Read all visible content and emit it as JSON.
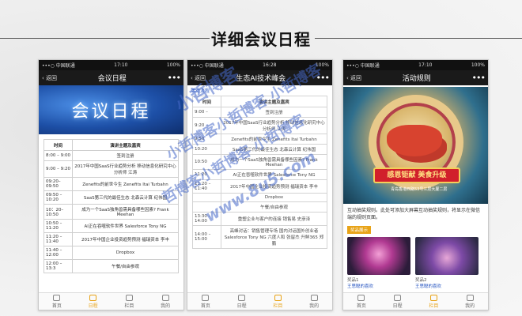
{
  "page": {
    "heading": "详细会议日程"
  },
  "phone1": {
    "status": {
      "carrier": "•••○ 中国联通",
      "time": "17:10",
      "battery": "100%"
    },
    "nav": {
      "back": "返回",
      "title": "会议日程",
      "more": "•••"
    },
    "banner_text": "会议日程",
    "table": {
      "headers": [
        "时间",
        "演讲主题及嘉宾"
      ],
      "rows": [
        [
          "8:00 – 9:00",
          "签到注册"
        ],
        [
          "9:00 – 9:20",
          "2017年中国SaaS行业趋势分析 移动信息化研究中心 分析师 江涛"
        ],
        [
          "09:20–09:50",
          "Zenefits的前世今生 Zenefits Itai Turbahn"
        ],
        [
          "09:50 – 10:20",
          "SaaS第三代的最佳生态 北森云计算 纪伟国"
        ],
        [
          "10：20–10:50",
          "成为一个SaaS独角兽需具备哪些因素? Frank Meehan"
        ],
        [
          "10:50 – 11:20",
          "AI正在吞噬软件世界 Salesforce Tony NG"
        ],
        [
          "11:20 – 11:40",
          "2017年中国企业投资趋势预测 福瑞资本 李丰"
        ],
        [
          "11:40 – 12:00",
          "Dropbox"
        ],
        [
          "12:00 – 13:3",
          "午餐/自由参观"
        ]
      ]
    },
    "tabs": [
      "首页",
      "日程",
      "栏目",
      "我的"
    ],
    "active_tab": "日程"
  },
  "phone2": {
    "status": {
      "carrier": "•••○ 中国联通",
      "time": "16:28",
      "battery": "100%"
    },
    "nav": {
      "back": "返回",
      "title": "生态AI技术峰会",
      "more": "•••"
    },
    "sub_label": "活动流程",
    "table": {
      "headers": [
        "时间",
        "演讲主题及嘉宾"
      ],
      "rows": [
        [
          "9:00 –",
          "签到注册"
        ],
        [
          "9:20 –",
          "2017年中国SaaS行业趋势分析 移动信息化研究中心 分析师 江涛"
        ],
        [
          "9:50",
          "Zenefits的前世今生 Zenefits Itai Turbahn"
        ],
        [
          "10:20",
          "SaaS第三代的最佳生态 北森云计算 纪伟国"
        ],
        [
          "10:50",
          "成为一个SaaS独角兽需具备哪些因素? Frank Meehan"
        ],
        [
          "11:20",
          "AI正在吞噬软件世界 Salesforce Tony NG"
        ],
        [
          "11:20 – 11:40",
          "2017年中国企业投资趋势预测 福瑞资本 李丰"
        ],
        [
          "",
          "Dropbox"
        ],
        [
          "",
          "午餐/自由参观"
        ],
        [
          "13:30 – 14:00",
          "重塑企业与客户的连接 销售易 史彦泽"
        ],
        [
          "14:00 – 15:00",
          "高峰对话：销售管理专场 国内对话国外创业者 Salesforce Tony NG 六度人和 张留杰 升鲜365 郑鹏"
        ]
      ]
    },
    "tabs": [
      "首页",
      "日程",
      "栏目",
      "我的"
    ],
    "active_tab": "栏目"
  },
  "phone3": {
    "status": {
      "carrier": "•••○ 中国联通",
      "time": "17:10",
      "battery": "100%"
    },
    "nav": {
      "back": "返回",
      "title": "活动规则",
      "more": "•••"
    },
    "poster_label": "感恩钜献 美食升级",
    "poster_foot": "青岛香港西路53号三层大厦二层",
    "rule_text": "互动抽奖规则。此处可添加大屏幕互动抽奖规则，将显示在微信端的规则页面。",
    "prize_head": "奖品展示",
    "prizes": [
      {
        "caption": "奖品1",
        "name": "王思聪的喜欢"
      },
      {
        "caption": "奖品2",
        "name": "王思聪的喜欢"
      }
    ],
    "tabs": [
      "首页",
      "日程",
      "栏目",
      "我的"
    ],
    "active_tab": "栏目"
  },
  "watermark": {
    "lines": [
      "小哲博客",
      "小哲博客小哲博客 小哲博客",
      "哲博客小哲博客 小哲博客"
    ],
    "domain": "www.8u5.com"
  }
}
